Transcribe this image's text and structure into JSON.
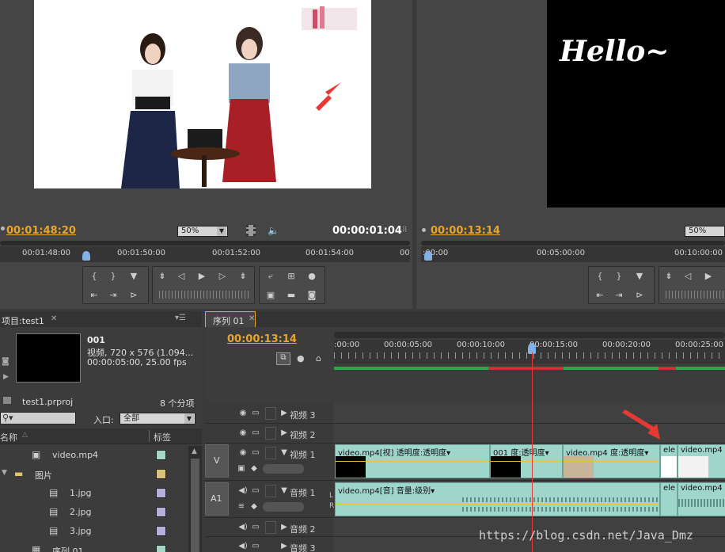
{
  "source_monitor": {
    "timecode_left": "00:01:48:20",
    "zoom": "50%",
    "timecode_right": "00:00:01:04",
    "ruler": [
      "00:01:48:00",
      "00:01:50:00",
      "00:01:52:00",
      "00:01:54:00",
      "00"
    ]
  },
  "program_monitor": {
    "overlay_text": "Hello~",
    "timecode": "00:00:13:14",
    "zoom": "50%",
    "ruler": [
      ":00:00",
      "00:05:00:00",
      "00:10:00:00"
    ]
  },
  "project": {
    "tab_title": "项目:test1",
    "clip_name": "001",
    "clip_info_1": "视频, 720 x 576 (1.094...",
    "clip_info_2": "00:00:05:00, 25.00 fps",
    "file_name": "test1.prproj",
    "item_count": "8 个分项",
    "entry_label": "入口:",
    "entry_value": "全部",
    "col_name": "名称",
    "col_label": "标签",
    "items": [
      {
        "name": "video.mp4",
        "icon": "video-file-icon",
        "color": "#a8d5c8"
      },
      {
        "name": "图片",
        "icon": "folder-icon",
        "color": "#d9c27a"
      },
      {
        "name": "1.jpg",
        "icon": "image-file-icon",
        "color": "#b8b0d8"
      },
      {
        "name": "2.jpg",
        "icon": "image-file-icon",
        "color": "#b8b0d8"
      },
      {
        "name": "3.jpg",
        "icon": "image-file-icon",
        "color": "#b8b0d8"
      },
      {
        "name": "序列 01",
        "icon": "sequence-icon",
        "color": "#a8d5c8"
      }
    ]
  },
  "timeline": {
    "tab_title": "序列 01",
    "timecode": "00:00:13:14",
    "ruler": [
      ":00:00",
      "00:00:05:00",
      "00:00:10:00",
      "00:00:15:00",
      "00:00:20:00",
      "00:00:25:00"
    ],
    "tracks": {
      "v3": "视频 3",
      "v2": "视频 2",
      "v1": "视频 1",
      "a1": "音频 1",
      "a2": "音频 2",
      "a3": "音频 3",
      "v_tag": "V",
      "a_tag": "A1",
      "l": "L",
      "r": "R"
    },
    "video_clips": [
      "video.mp4[视] 透明度:透明度▾",
      "001 度:透明度▾",
      "video.mp4 度:透明度▾",
      "ele",
      "video.mp4"
    ],
    "audio_clips": [
      "video.mp4[音] 音量:级别▾",
      "ele",
      "video.mp4"
    ]
  },
  "watermark": "https://blog.csdn.net/Java_Dmz"
}
